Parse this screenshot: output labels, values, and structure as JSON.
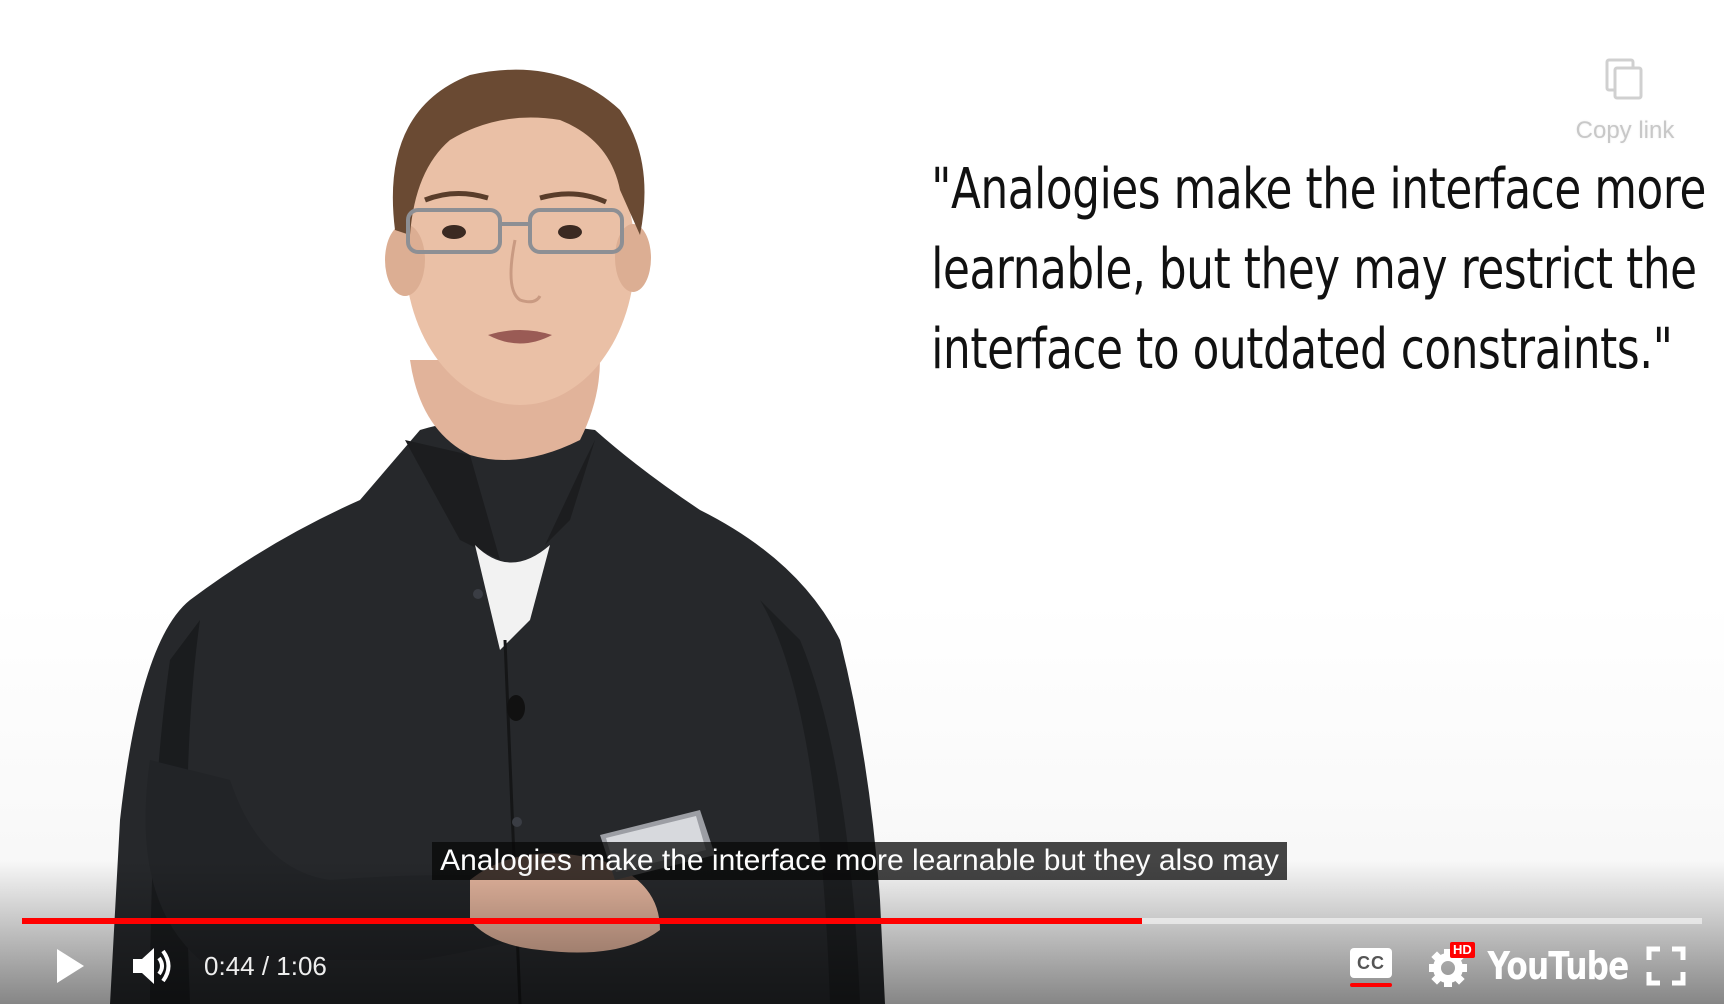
{
  "video": {
    "quote_lines": [
      "\"Analogies make the interface more",
      "learnable, but they may restrict the",
      "interface to outdated constraints.\""
    ],
    "caption": "Analogies make the interface more learnable but they also may"
  },
  "overlay": {
    "copy_link_label": "Copy link",
    "copy_icon": "copy-icon"
  },
  "player": {
    "progress_fraction": 0.6667,
    "current_time": "0:44",
    "separator": " / ",
    "duration": "1:06",
    "accent_color": "#ff0000",
    "hd_badge": "HD",
    "brand": "YouTube",
    "cc_label": "CC",
    "icons": [
      "play-icon",
      "volume-icon",
      "cc-icon",
      "settings-icon",
      "youtube-logo",
      "fullscreen-icon"
    ]
  }
}
